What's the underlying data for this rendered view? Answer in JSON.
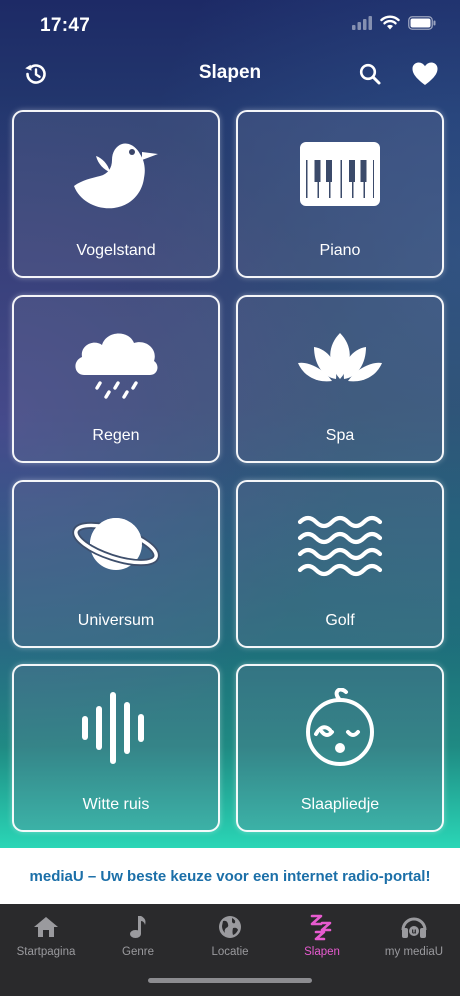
{
  "status_bar": {
    "time": "17:47"
  },
  "header": {
    "title": "Slapen"
  },
  "tiles": [
    {
      "label": "Vogelstand",
      "icon": "bird-icon"
    },
    {
      "label": "Piano",
      "icon": "piano-icon"
    },
    {
      "label": "Regen",
      "icon": "rain-cloud-icon"
    },
    {
      "label": "Spa",
      "icon": "lotus-icon"
    },
    {
      "label": "Universum",
      "icon": "planet-icon"
    },
    {
      "label": "Golf",
      "icon": "waves-icon"
    },
    {
      "label": "Witte ruis",
      "icon": "soundwave-icon"
    },
    {
      "label": "Slaapliedje",
      "icon": "baby-face-icon"
    }
  ],
  "banner": {
    "text": "mediaU – Uw beste keuze voor een internet radio-portal!"
  },
  "tabbar": {
    "items": [
      {
        "label": "Startpagina",
        "icon": "home-icon"
      },
      {
        "label": "Genre",
        "icon": "music-note-icon"
      },
      {
        "label": "Locatie",
        "icon": "globe-icon"
      },
      {
        "label": "Slapen",
        "icon": "zzz-icon",
        "active": true
      },
      {
        "label": "my mediaU",
        "icon": "headphones-icon"
      }
    ]
  },
  "colors": {
    "active_tab": "#e75bd0",
    "banner_text": "#1b6fa8",
    "tabbar_bg": "#2a2a2c"
  }
}
